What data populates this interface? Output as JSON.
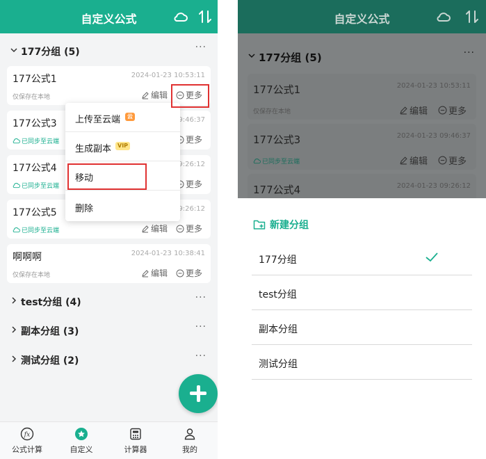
{
  "app": {
    "title": "自定义公式"
  },
  "left": {
    "expanded_group": {
      "label": "177分组 (5)"
    },
    "formulas": [
      {
        "name": "177公式1",
        "time": "2024-01-23 10:53:11",
        "status": "仅保存在本地",
        "synced": false
      },
      {
        "name": "177公式3",
        "time": "09:46:37",
        "status": "已同步至云端",
        "synced": true
      },
      {
        "name": "177公式4",
        "time": "09:26:12",
        "status": "已同步至云端",
        "synced": true
      },
      {
        "name": "177公式5",
        "time": "09:26:12",
        "status": "已同步至云端",
        "synced": true
      },
      {
        "name": "啊啊啊",
        "time": "2024-01-23 10:38:41",
        "status": "仅保存在本地",
        "synced": false
      }
    ],
    "actions": {
      "edit": "编辑",
      "more": "更多"
    },
    "collapsed_groups": [
      "test分组 (4)",
      "副本分组 (3)",
      "测试分组 (2)"
    ],
    "popup_menu": [
      {
        "label": "上传至云端",
        "badge": "云"
      },
      {
        "label": "生成副本",
        "badge": "VIP"
      },
      {
        "label": "移动",
        "badge": ""
      },
      {
        "label": "删除",
        "badge": ""
      }
    ],
    "tabs": [
      {
        "label": "公式计算",
        "icon": "fx-icon"
      },
      {
        "label": "自定义",
        "icon": "star-icon",
        "active": true
      },
      {
        "label": "计算器",
        "icon": "calculator-icon"
      },
      {
        "label": "我的",
        "icon": "user-icon"
      }
    ]
  },
  "right": {
    "group_label": "177分组 (5)",
    "formulas": [
      {
        "name": "177公式1",
        "time": "2024-01-23 10:53:11",
        "status": "仅保存在本地",
        "synced": false
      },
      {
        "name": "177公式3",
        "time": "2024-01-23 09:46:37",
        "status": "已同步至云端",
        "synced": true
      },
      {
        "name": "177公式4",
        "time": "2024-01-23 09:26:12",
        "status": "",
        "synced": false
      }
    ],
    "actions": {
      "edit": "编辑",
      "more": "更多"
    },
    "sheet": {
      "new_group": "新建分组",
      "options": [
        {
          "label": "177分组",
          "selected": true
        },
        {
          "label": "test分组",
          "selected": false
        },
        {
          "label": "副本分组",
          "selected": false
        },
        {
          "label": "测试分组",
          "selected": false
        }
      ]
    }
  },
  "colors": {
    "accent": "#1aaf8f",
    "highlight_box": "#e03131"
  }
}
